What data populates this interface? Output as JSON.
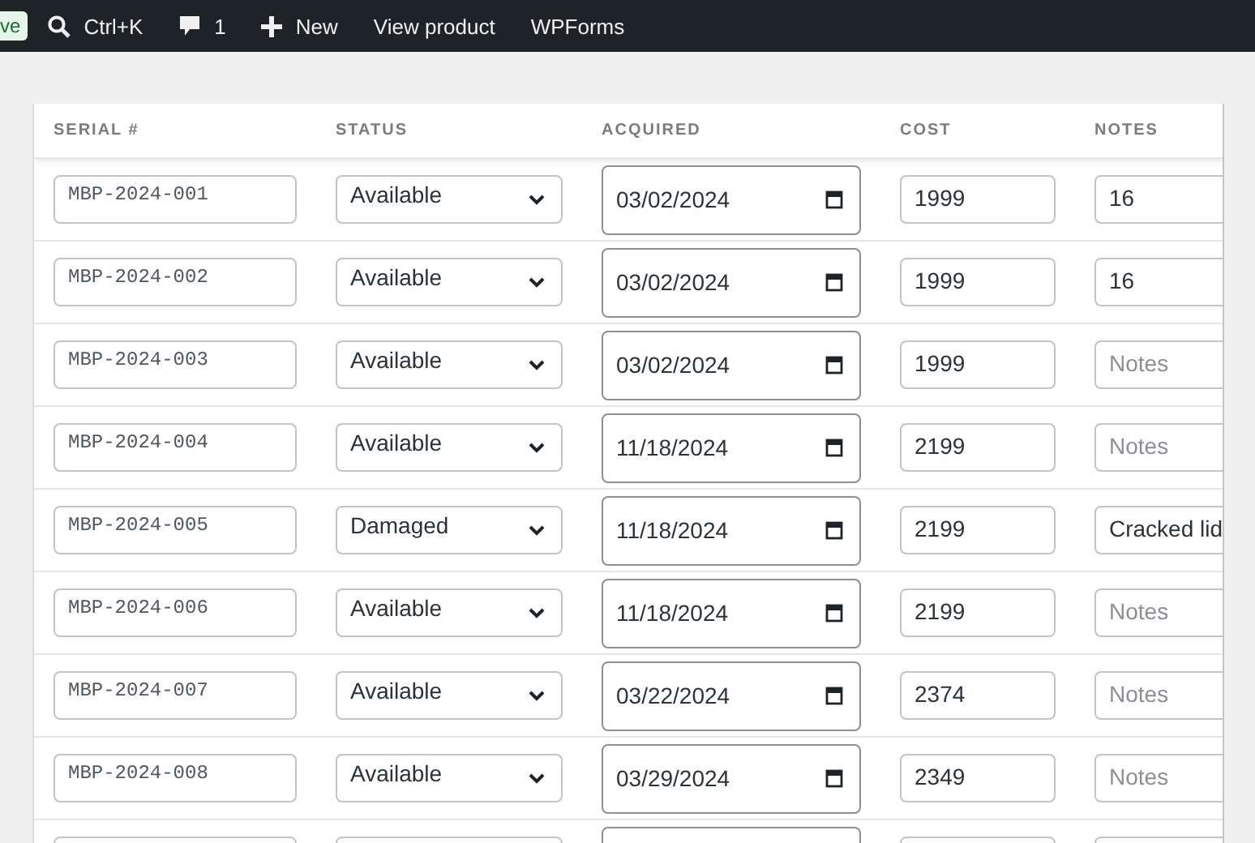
{
  "admin_bar": {
    "badge": "ve",
    "items": [
      {
        "kind": "search",
        "label": "Ctrl+K"
      },
      {
        "kind": "comments",
        "label": "1"
      },
      {
        "kind": "new",
        "label": "New"
      },
      {
        "kind": "link",
        "label": "View product"
      },
      {
        "kind": "link",
        "label": "WPForms"
      }
    ]
  },
  "table": {
    "columns": [
      "SERIAL #",
      "STATUS",
      "ACQUIRED",
      "COST",
      "NOTES"
    ],
    "rows": [
      {
        "serial": "MBP-2024-001",
        "status": "Available",
        "acquired": "03/02/2024",
        "cost": "1999",
        "notes": "16"
      },
      {
        "serial": "MBP-2024-002",
        "status": "Available",
        "acquired": "03/02/2024",
        "cost": "1999",
        "notes": "16"
      },
      {
        "serial": "MBP-2024-003",
        "status": "Available",
        "acquired": "03/02/2024",
        "cost": "1999",
        "notes_placeholder": "Notes"
      },
      {
        "serial": "MBP-2024-004",
        "status": "Available",
        "acquired": "11/18/2024",
        "cost": "2199",
        "notes_placeholder": "Notes"
      },
      {
        "serial": "MBP-2024-005",
        "status": "Damaged",
        "acquired": "11/18/2024",
        "cost": "2199",
        "notes": "Cracked lid"
      },
      {
        "serial": "MBP-2024-006",
        "status": "Available",
        "acquired": "11/18/2024",
        "cost": "2199",
        "notes_placeholder": "Notes"
      },
      {
        "serial": "MBP-2024-007",
        "status": "Available",
        "acquired": "03/22/2024",
        "cost": "2374",
        "notes_placeholder": "Notes"
      },
      {
        "serial": "MBP-2024-008",
        "status": "Available",
        "acquired": "03/29/2024",
        "cost": "2349",
        "notes_placeholder": "Notes"
      }
    ]
  }
}
